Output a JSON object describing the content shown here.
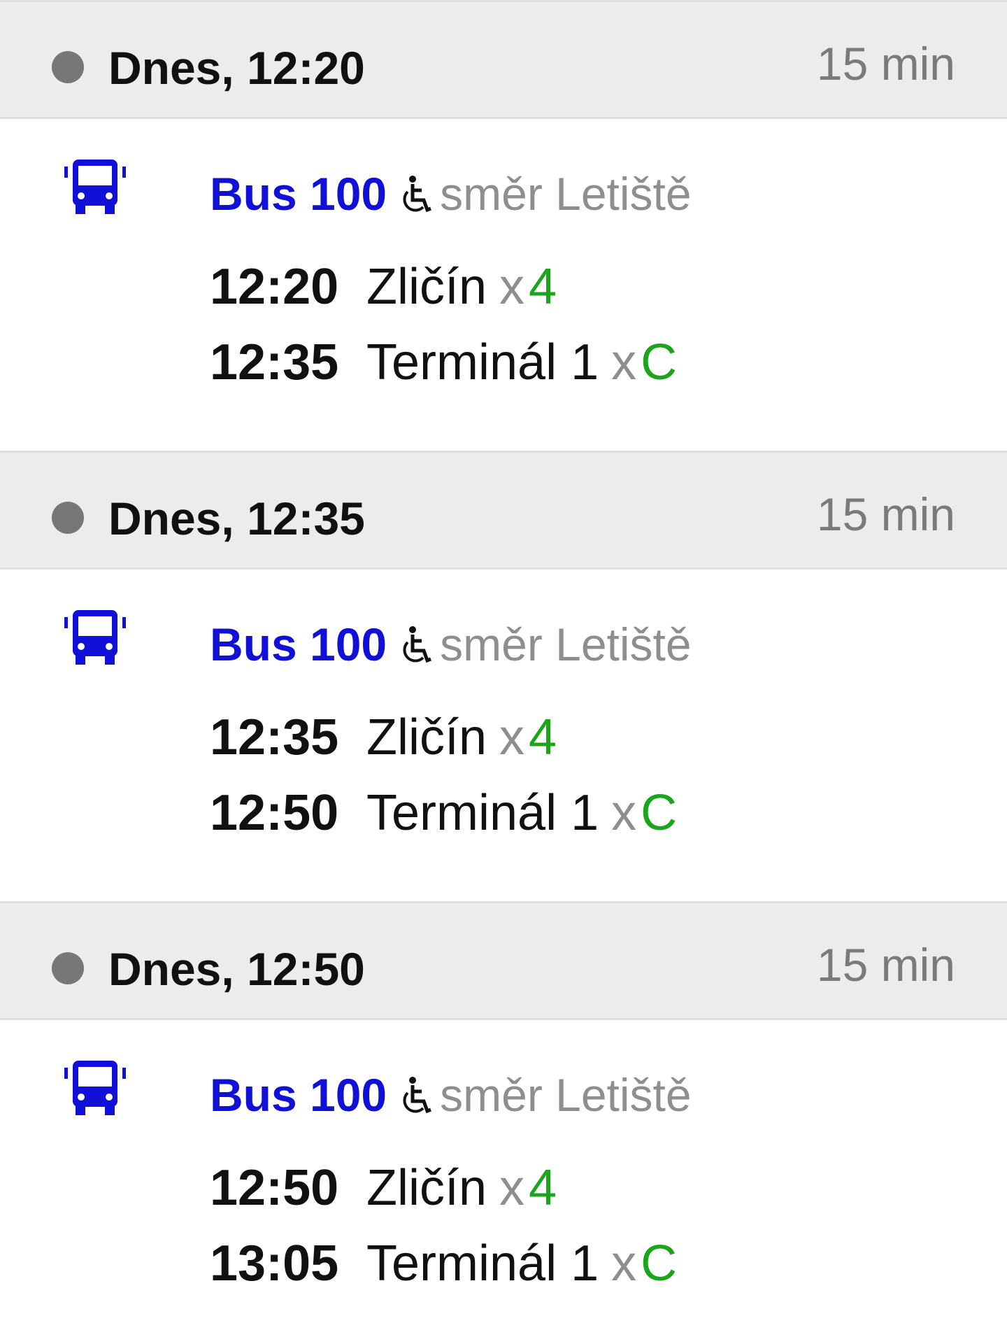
{
  "colors": {
    "header_bg": "#ececec",
    "line_blue": "#1010d8",
    "platform_green": "#1aa51a",
    "muted_gray": "#8e8e8e",
    "status_dot": "#777777"
  },
  "icons": {
    "status": "status-dot-icon",
    "vehicle": "bus-icon",
    "accessibility": "wheelchair-icon"
  },
  "connections": [
    {
      "date": "Dnes, 12:20",
      "duration": "15 min",
      "line": "Bus 100",
      "direction": "směr Letiště",
      "stops": [
        {
          "time": "12:20",
          "name": "Zličín",
          "separator": "x",
          "platform": "4"
        },
        {
          "time": "12:35",
          "name": "Terminál 1",
          "separator": "x",
          "platform": "C"
        }
      ]
    },
    {
      "date": "Dnes, 12:35",
      "duration": "15 min",
      "line": "Bus 100",
      "direction": "směr Letiště",
      "stops": [
        {
          "time": "12:35",
          "name": "Zličín",
          "separator": "x",
          "platform": "4"
        },
        {
          "time": "12:50",
          "name": "Terminál 1",
          "separator": "x",
          "platform": "C"
        }
      ]
    },
    {
      "date": "Dnes, 12:50",
      "duration": "15 min",
      "line": "Bus 100",
      "direction": "směr Letiště",
      "stops": [
        {
          "time": "12:50",
          "name": "Zličín",
          "separator": "x",
          "platform": "4"
        },
        {
          "time": "13:05",
          "name": "Terminál 1",
          "separator": "x",
          "platform": "C"
        }
      ]
    }
  ]
}
